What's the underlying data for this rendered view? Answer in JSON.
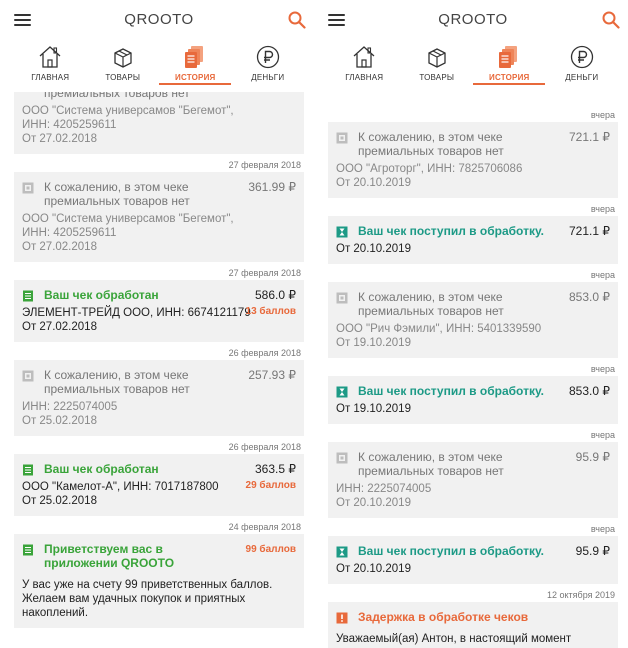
{
  "app": {
    "logo": "QROOTO"
  },
  "nav": [
    {
      "label": "ГЛАВНАЯ",
      "icon": "home-icon"
    },
    {
      "label": "ТОВАРЫ",
      "icon": "box-icon"
    },
    {
      "label": "ИСТОРИЯ",
      "icon": "receipts-icon",
      "active": true
    },
    {
      "label": "ДЕНЬГИ",
      "icon": "ruble-icon"
    }
  ],
  "colors": {
    "accent": "#e8693b",
    "green": "#3aa43a",
    "teal": "#1d9a86",
    "card": "#f1f1f1"
  },
  "left": {
    "c0": {
      "title": "премиальных товаров нет",
      "line1": "ООО \"Система универсамов \"Бегемот\",",
      "line2": "ИНН: 4205259611",
      "line3": "От 27.02.2018"
    },
    "d1": "27 февраля 2018",
    "c1": {
      "title": "К сожалению, в этом чеке премиальных товаров нет",
      "amount": "361.99 ₽",
      "line1": "ООО \"Система универсамов \"Бегемот\",",
      "line2": "ИНН: 4205259611",
      "line3": "От 27.02.2018"
    },
    "d2": "27 февраля 2018",
    "c2": {
      "title": "Ваш чек обработан",
      "amount": "586.0 ₽",
      "line1": "ЭЛЕМЕНТ-ТРЕЙД ООО, ИНН: 6674121179",
      "line2": "От 27.02.2018",
      "bonus": "13 баллов"
    },
    "d3": "26 февраля 2018",
    "c3": {
      "title": "К сожалению, в этом чеке премиальных товаров нет",
      "amount": "257.93 ₽",
      "line1": "ИНН: 2225074005",
      "line2": "От 25.02.2018"
    },
    "d4": "26 февраля 2018",
    "c4": {
      "title": "Ваш чек обработан",
      "amount": "363.5 ₽",
      "line1": "ООО \"Камелот-А\", ИНН: 7017187800",
      "line2": "От 25.02.2018",
      "bonus": "29 баллов"
    },
    "d5": "24 февраля 2018",
    "c5": {
      "title": "Приветствуем вас в приложении QROOTO",
      "bonus": "99 баллов",
      "body": "У вас уже на счету 99 приветственных баллов. Желаем вам удачных покупок и приятных накоплений."
    }
  },
  "right": {
    "d0": "вчера",
    "c1": {
      "title": "К сожалению, в этом чеке премиальных товаров нет",
      "amount": "721.1 ₽",
      "line1": "ООО \"Агроторг\", ИНН: 7825706086",
      "line2": "От 20.10.2019"
    },
    "d1": "вчера",
    "c2": {
      "title": "Ваш чек поступил в обработку.",
      "amount": "721.1 ₽",
      "line1": "От 20.10.2019"
    },
    "d2": "вчера",
    "c3": {
      "title": "К сожалению, в этом чеке премиальных товаров нет",
      "amount": "853.0 ₽",
      "line1": "ООО \"Рич Фэмили\", ИНН: 5401339590",
      "line2": "От 19.10.2019"
    },
    "d3": "вчера",
    "c4": {
      "title": "Ваш чек поступил в обработку.",
      "amount": "853.0 ₽",
      "line1": "От 19.10.2019"
    },
    "d4": "вчера",
    "c5": {
      "title": "К сожалению, в этом чеке премиальных товаров нет",
      "amount": "95.9 ₽",
      "line1": "ИНН: 2225074005",
      "line2": "От 20.10.2019"
    },
    "d5": "вчера",
    "c6": {
      "title": "Ваш чек поступил в обработку.",
      "amount": "95.9 ₽",
      "line1": "От 20.10.2019"
    },
    "d6": "12 октября 2019",
    "c7": {
      "title": "Задержка в обработке чеков",
      "body": "Уважаемый(ая) Антон, в настоящий момент"
    }
  }
}
